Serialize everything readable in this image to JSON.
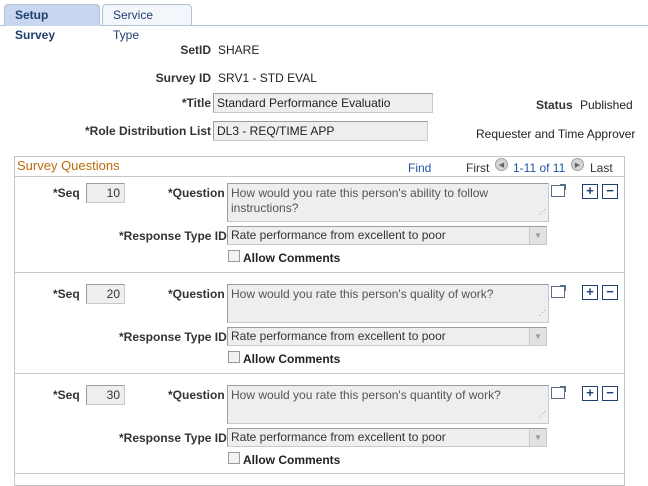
{
  "tabs": [
    {
      "label": "Setup Survey"
    },
    {
      "label": "Service Type"
    }
  ],
  "header": {
    "setid_label": "SetID",
    "setid_value": "SHARE",
    "survey_id_label": "Survey ID",
    "survey_id_value": "SRV1 - STD EVAL",
    "title_label": "*Title",
    "title_value": "Standard Performance Evaluatio",
    "role_label": "*Role Distribution List",
    "role_value": "DL3 - REQ/TIME APP",
    "role_desc": "Requester and Time Approver",
    "status_label": "Status",
    "status_value": "Published"
  },
  "group": {
    "title": "Survey Questions",
    "find": "Find",
    "first": "First",
    "range": "1-11 of 11",
    "last": "Last"
  },
  "labels": {
    "seq": "*Seq",
    "question": "*Question",
    "response_type": "*Response Type ID",
    "allow_comments": "Allow Comments",
    "add": "+",
    "remove": "−"
  },
  "questions": [
    {
      "seq": "10",
      "text": "How would you rate this person's ability to follow instructions?",
      "response": "Rate performance from excellent to poor"
    },
    {
      "seq": "20",
      "text": "How would you rate this person's quality of work?",
      "response": "Rate performance from excellent to poor"
    },
    {
      "seq": "30",
      "text": "How would you rate this person's quantity of work?",
      "response": "Rate performance from excellent to poor"
    }
  ],
  "icons": {
    "prev": "left-arrow-icon",
    "next": "right-arrow-icon",
    "zoom": "expand-icon"
  }
}
